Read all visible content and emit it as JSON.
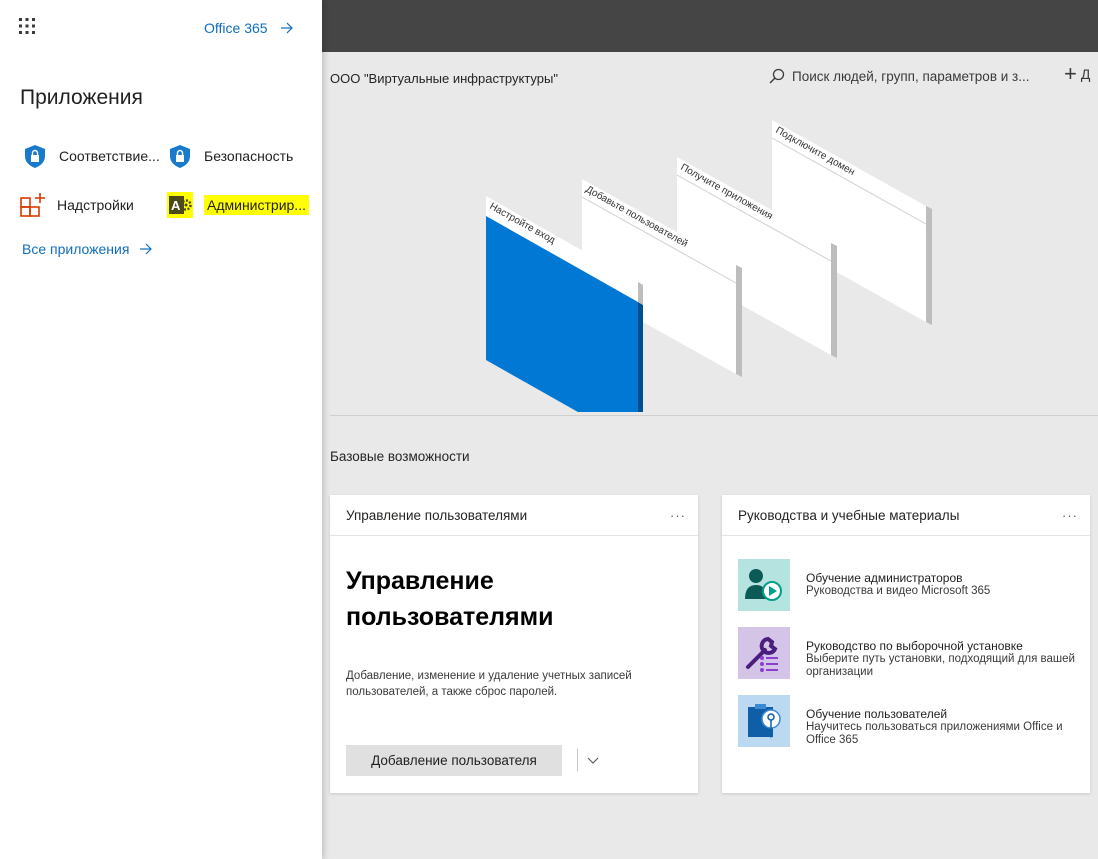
{
  "header": {
    "org_name": "ООО \"Виртуальные инфраструктуры\"",
    "search_placeholder": "Поиск людей, групп, параметров и з...",
    "add_label": "Д"
  },
  "hero": {
    "steps": [
      "Настройте вход",
      "Добавьте пользователей",
      "Получите приложения",
      "Подключите домен"
    ]
  },
  "section": {
    "title": "Базовые возможности"
  },
  "card_users": {
    "header": "Управление пользователями",
    "more": "···",
    "big_title": "Управление пользователями",
    "description": "Добавление, изменение и удаление учетных записей пользователей, а также сброс паролей.",
    "button_label": "Добавление пользователя"
  },
  "card_guides": {
    "header": "Руководства и учебные материалы",
    "more": "···",
    "items": [
      {
        "title": "Обучение администраторов",
        "subtitle": "Руководства и видео Microsoft 365",
        "icon": "admin-training-icon",
        "color": "#b4e3e0"
      },
      {
        "title": "Руководство по выборочной установке",
        "subtitle": "Выберите путь установки, подходящий для вашей организации",
        "icon": "setup-tools-icon",
        "color": "#d4c5e8"
      },
      {
        "title": "Обучение пользователей",
        "subtitle": "Научитесь пользоваться приложениями Office и Office 365",
        "icon": "user-training-icon",
        "color": "#bcd9f2"
      }
    ]
  },
  "panel": {
    "office_link": "Office 365",
    "title": "Приложения",
    "apps": [
      {
        "label": "Соответствие...",
        "icon": "shield-lock-icon"
      },
      {
        "label": "Безопасность",
        "icon": "shield-lock-icon"
      },
      {
        "label": "Надстройки",
        "icon": "add-ins-icon"
      },
      {
        "label": "Администрир...",
        "icon": "admin-icon",
        "highlighted": true
      }
    ],
    "all_apps": "Все приложения"
  },
  "colors": {
    "accent": "#106ebe",
    "topbar": "#464545",
    "highlight": "#ffff00",
    "hero_blue": "#0078d4"
  }
}
